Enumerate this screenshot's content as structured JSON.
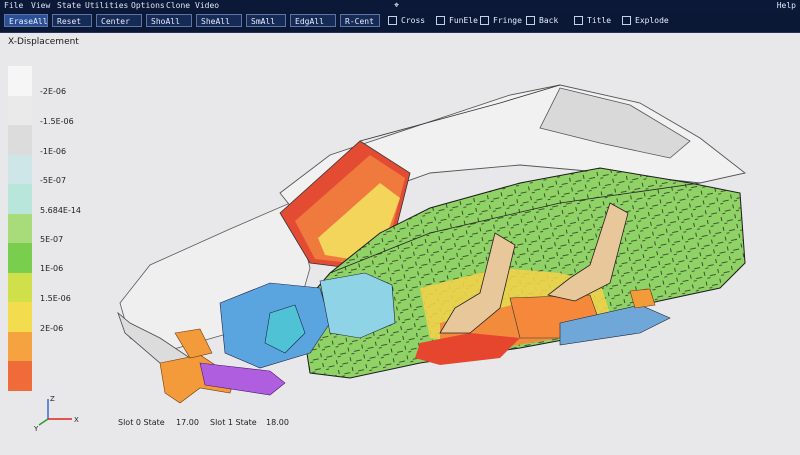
{
  "menubar": {
    "items": [
      "File",
      "View",
      "State",
      "Utilities",
      "Options",
      "Clone",
      "Video"
    ],
    "center_icon": "⌖",
    "help": "Help"
  },
  "toolbar": {
    "buttons": [
      "EraseAll",
      "Reset",
      "Center",
      "ShoAll",
      "SheAll",
      "SmAll",
      "EdgAll",
      "R-Cent"
    ],
    "checkboxes": [
      "Cross",
      "FunEle",
      "Fringe",
      "Back",
      "Title",
      "Explode"
    ]
  },
  "viewport": {
    "title": "X-Displacement",
    "legend": {
      "labels": [
        "-2E-06",
        "-1.5E-06",
        "-1E-06",
        "-5E-07",
        "5.684E-14",
        "5E-07",
        "1E-06",
        "1.5E-06",
        "2E-06"
      ],
      "colors": [
        "#f6f6f6",
        "#eaeaea",
        "#dcdcdc",
        "#cfe6e9",
        "#b9e6da",
        "#a8dc7a",
        "#79cf4d",
        "#cfe04b",
        "#f3dc4e",
        "#f4a340",
        "#ef6b3a",
        "#e43a2d"
      ]
    },
    "slots": {
      "slot0": "Slot 0 State",
      "slot0_value": "17.00",
      "slot1": "Slot 1 State",
      "slot1_value": "18.00"
    },
    "axes": {
      "z": "Z",
      "y": "Y",
      "x": "X"
    }
  }
}
